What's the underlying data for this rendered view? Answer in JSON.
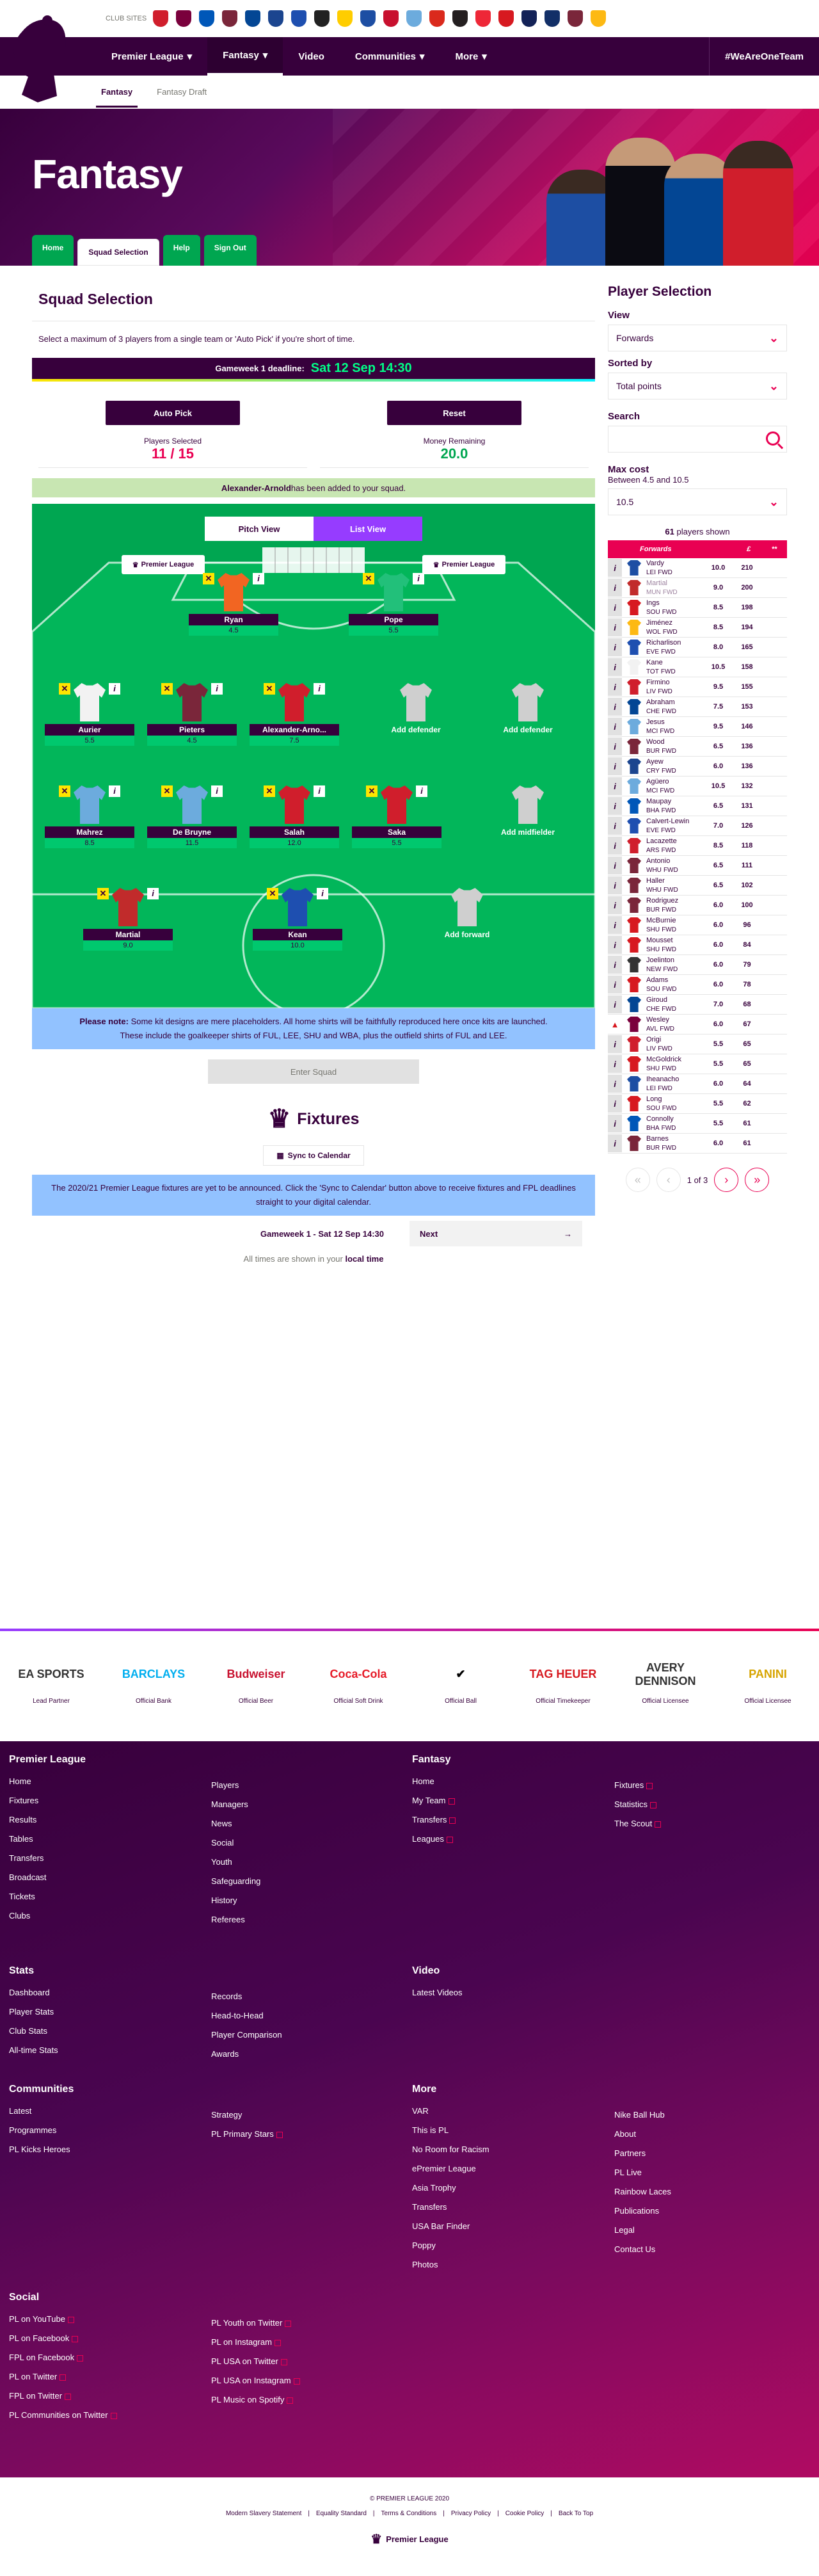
{
  "clubbar": {
    "label": "CLUB SITES"
  },
  "colors": {
    "purple": "#37003c",
    "pink": "#e90052",
    "green": "#00ff87",
    "cyan": "#05f0ff"
  },
  "nav": {
    "items": [
      "Premier League",
      "Fantasy",
      "Video",
      "Communities",
      "More"
    ],
    "right": "#WeAreOneTeam"
  },
  "subnav": [
    "Fantasy",
    "Fantasy Draft"
  ],
  "hero": {
    "title": "Fantasy",
    "tabs": [
      "Home",
      "Squad Selection",
      "Help",
      "Sign Out"
    ]
  },
  "squad": {
    "title": "Squad Selection",
    "note": "Select a maximum of 3 players from a single team or 'Auto Pick' if you're short of time.",
    "deadline_label": "Gameweek 1 deadline:",
    "deadline": "Sat 12 Sep 14:30",
    "auto": "Auto Pick",
    "reset": "Reset",
    "players_label": "Players Selected",
    "players_val": "11 / 15",
    "money_label": "Money Remaining",
    "money_val": "20.0",
    "added_name": "Alexander-Arnold",
    "added_rest": " has been added to your squad.",
    "pitch_view": "Pitch View",
    "list_view": "List View",
    "board": "Premier League",
    "pnote_b": "Please note:",
    "pnote1": " Some kit designs are mere placeholders. All home shirts will be faithfully reproduced here once kits are launched.",
    "pnote2": "These include the goalkeeper shirts of FUL, LEE, SHU and WBA, plus the outfield shirts of FUL and LEE.",
    "enter": "Enter Squad"
  },
  "pitch": {
    "gk": [
      {
        "name": "Ryan",
        "pts": "4.5",
        "color": "#f26522"
      },
      {
        "name": "Pope",
        "pts": "5.5",
        "color": "#22c07a"
      }
    ],
    "def": [
      {
        "name": "Aurier",
        "pts": "5.5",
        "color": "#f2f2f2"
      },
      {
        "name": "Pieters",
        "pts": "4.5",
        "color": "#7a263a"
      },
      {
        "name": "Alexander-Arno...",
        "pts": "7.5",
        "color": "#d01e2c"
      },
      {
        "name": "Add defender",
        "pts": "",
        "color": "#cfcfcf"
      },
      {
        "name": "Add defender",
        "pts": "",
        "color": "#cfcfcf"
      }
    ],
    "mid": [
      {
        "name": "Mahrez",
        "pts": "8.5",
        "color": "#6cabdd"
      },
      {
        "name": "De Bruyne",
        "pts": "11.5",
        "color": "#6cabdd"
      },
      {
        "name": "Salah",
        "pts": "12.0",
        "color": "#d01e2c"
      },
      {
        "name": "Saka",
        "pts": "5.5",
        "color": "#d01e2c"
      },
      {
        "name": "Add midfielder",
        "pts": "",
        "color": "#cfcfcf"
      }
    ],
    "fwd": [
      {
        "name": "Martial",
        "pts": "9.0",
        "color": "#c12b2b"
      },
      {
        "name": "Kean",
        "pts": "10.0",
        "color": "#1e4fb0"
      },
      {
        "name": "Add forward",
        "pts": "",
        "color": "#cfcfcf"
      }
    ]
  },
  "fixtures": {
    "title": "Fixtures",
    "sync": "Sync to Calendar",
    "note": "The 2020/21 Premier League fixtures are yet to be announced. Click the 'Sync to Calendar' button above to receive fixtures and FPL deadlines straight to your digital calendar.",
    "gw": "Gameweek 1 - Sat 12 Sep 14:30",
    "next": "Next",
    "tz1": "All times are shown in your ",
    "tz2": "local time"
  },
  "side": {
    "title": "Player Selection",
    "view_label": "View",
    "view": "Forwards",
    "sort_label": "Sorted by",
    "sort": "Total points",
    "search_label": "Search",
    "max_label": "Max cost",
    "max_range": "Between 4.5 and 10.5",
    "max": "10.5",
    "shown_n": "61",
    "shown": " players shown",
    "head": "Forwards",
    "hc": "£",
    "hp": "**",
    "players": [
      {
        "n": "Vardy",
        "t": "LEI",
        "c": "10.0",
        "p": "210",
        "col": "#1d4ea3"
      },
      {
        "n": "Martial",
        "t": "MUN",
        "c": "9.0",
        "p": "200",
        "col": "#c12b2b",
        "dim": true
      },
      {
        "n": "Ings",
        "t": "SOU",
        "c": "8.5",
        "p": "198",
        "col": "#d71920"
      },
      {
        "n": "Jiménez",
        "t": "WOL",
        "c": "8.5",
        "p": "194",
        "col": "#fdb913"
      },
      {
        "n": "Richarlison",
        "t": "EVE",
        "c": "8.0",
        "p": "165",
        "col": "#1e4fb0"
      },
      {
        "n": "Kane",
        "t": "TOT",
        "c": "10.5",
        "p": "158",
        "col": "#f2f2f2"
      },
      {
        "n": "Firmino",
        "t": "LIV",
        "c": "9.5",
        "p": "155",
        "col": "#d01e2c"
      },
      {
        "n": "Abraham",
        "t": "CHE",
        "c": "7.5",
        "p": "153",
        "col": "#034694"
      },
      {
        "n": "Jesus",
        "t": "MCI",
        "c": "9.5",
        "p": "146",
        "col": "#6cabdd"
      },
      {
        "n": "Wood",
        "t": "BUR",
        "c": "6.5",
        "p": "136",
        "col": "#7a263a"
      },
      {
        "n": "Ayew",
        "t": "CRY",
        "c": "6.0",
        "p": "136",
        "col": "#1b458f"
      },
      {
        "n": "Agüero",
        "t": "MCI",
        "c": "10.5",
        "p": "132",
        "col": "#6cabdd"
      },
      {
        "n": "Maupay",
        "t": "BHA",
        "c": "6.5",
        "p": "131",
        "col": "#0057b8"
      },
      {
        "n": "Calvert-Lewin",
        "t": "EVE",
        "c": "7.0",
        "p": "126",
        "col": "#1e4fb0"
      },
      {
        "n": "Lacazette",
        "t": "ARS",
        "c": "8.5",
        "p": "118",
        "col": "#d01e2c"
      },
      {
        "n": "Antonio",
        "t": "WHU",
        "c": "6.5",
        "p": "111",
        "col": "#7a263a"
      },
      {
        "n": "Haller",
        "t": "WHU",
        "c": "6.5",
        "p": "102",
        "col": "#7a263a"
      },
      {
        "n": "Rodriguez",
        "t": "BUR",
        "c": "6.0",
        "p": "100",
        "col": "#7a263a"
      },
      {
        "n": "McBurnie",
        "t": "SHU",
        "c": "6.0",
        "p": "96",
        "col": "#d71920"
      },
      {
        "n": "Mousset",
        "t": "SHU",
        "c": "6.0",
        "p": "84",
        "col": "#d71920"
      },
      {
        "n": "Joelinton",
        "t": "NEW",
        "c": "6.0",
        "p": "79",
        "col": "#333333"
      },
      {
        "n": "Adams",
        "t": "SOU",
        "c": "6.0",
        "p": "78",
        "col": "#d71920"
      },
      {
        "n": "Giroud",
        "t": "CHE",
        "c": "7.0",
        "p": "68",
        "col": "#034694"
      },
      {
        "n": "Wesley",
        "t": "AVL",
        "c": "6.0",
        "p": "67",
        "col": "#7a003c",
        "warn": true
      },
      {
        "n": "Origi",
        "t": "LIV",
        "c": "5.5",
        "p": "65",
        "col": "#d01e2c"
      },
      {
        "n": "McGoldrick",
        "t": "SHU",
        "c": "5.5",
        "p": "65",
        "col": "#d71920"
      },
      {
        "n": "Iheanacho",
        "t": "LEI",
        "c": "6.0",
        "p": "64",
        "col": "#1d4ea3"
      },
      {
        "n": "Long",
        "t": "SOU",
        "c": "5.5",
        "p": "62",
        "col": "#d71920"
      },
      {
        "n": "Connolly",
        "t": "BHA",
        "c": "5.5",
        "p": "61",
        "col": "#0057b8"
      },
      {
        "n": "Barnes",
        "t": "BUR",
        "c": "6.0",
        "p": "61",
        "col": "#7a263a"
      }
    ],
    "pos": "FWD",
    "page": "1 of 3"
  },
  "partners": [
    {
      "logo": "EA SPORTS",
      "label": "Lead Partner",
      "color": "#333333"
    },
    {
      "logo": "BARCLAYS",
      "label": "Official Bank",
      "color": "#00aeef"
    },
    {
      "logo": "Budweiser",
      "label": "Official Beer",
      "color": "#c8102e"
    },
    {
      "logo": "Coca-Cola",
      "label": "Official Soft Drink",
      "color": "#e61a27"
    },
    {
      "logo": "✔",
      "label": "Official Ball",
      "color": "#000000"
    },
    {
      "logo": "TAG HEUER",
      "label": "Official Timekeeper",
      "color": "#d71920"
    },
    {
      "logo": "AVERY DENNISON",
      "label": "Official Licensee",
      "color": "#333333"
    },
    {
      "logo": "PANINI",
      "label": "Official Licensee",
      "color": "#d7a400"
    }
  ],
  "footer": {
    "pl": {
      "title": "Premier League",
      "a": [
        "Home",
        "Fixtures",
        "Results",
        "Tables",
        "Transfers",
        "Broadcast",
        "Tickets",
        "Clubs"
      ],
      "b": [
        "Players",
        "Managers",
        "News",
        "Social",
        "Youth",
        "Safeguarding",
        "History",
        "Referees"
      ]
    },
    "fantasy": {
      "title": "Fantasy",
      "a": [
        "Home",
        "My Team",
        "Transfers",
        "Leagues"
      ],
      "b": [
        "Fixtures",
        "Statistics",
        "The Scout"
      ]
    },
    "stats": {
      "title": "Stats",
      "a": [
        "Dashboard",
        "Player Stats",
        "Club Stats",
        "All-time Stats"
      ],
      "b": [
        "Records",
        "Head-to-Head",
        "Player Comparison",
        "Awards"
      ]
    },
    "video": {
      "title": "Video",
      "a": [
        "Latest Videos"
      ]
    },
    "comm": {
      "title": "Communities",
      "a": [
        "Latest",
        "Programmes",
        "PL Kicks Heroes"
      ],
      "b": [
        "Strategy",
        "PL Primary Stars"
      ]
    },
    "more": {
      "title": "More",
      "a": [
        "VAR",
        "This is PL",
        "No Room for Racism",
        "ePremier League",
        "Asia Trophy",
        "Transfers",
        "USA Bar Finder",
        "Poppy",
        "Photos"
      ],
      "b": [
        "Nike Ball Hub",
        "About",
        "Partners",
        "PL Live",
        "Rainbow Laces",
        "Publications",
        "Legal",
        "Contact Us"
      ]
    },
    "social": {
      "title": "Social",
      "a": [
        "PL on YouTube",
        "PL on Facebook",
        "FPL on Facebook",
        "PL on Twitter",
        "FPL on Twitter",
        "PL Communities on Twitter"
      ],
      "b": [
        "PL Youth on Twitter",
        "PL on Instagram",
        "PL USA on Twitter",
        "PL USA on Instagram",
        "PL Music on Spotify"
      ]
    }
  },
  "bottom": {
    "copy": "© PREMIER LEAGUE 2020",
    "links": [
      "Modern Slavery Statement",
      "Equality Standard",
      "Terms & Conditions",
      "Privacy Policy",
      "Cookie Policy",
      "Back To Top"
    ],
    "logo": "Premier League"
  }
}
